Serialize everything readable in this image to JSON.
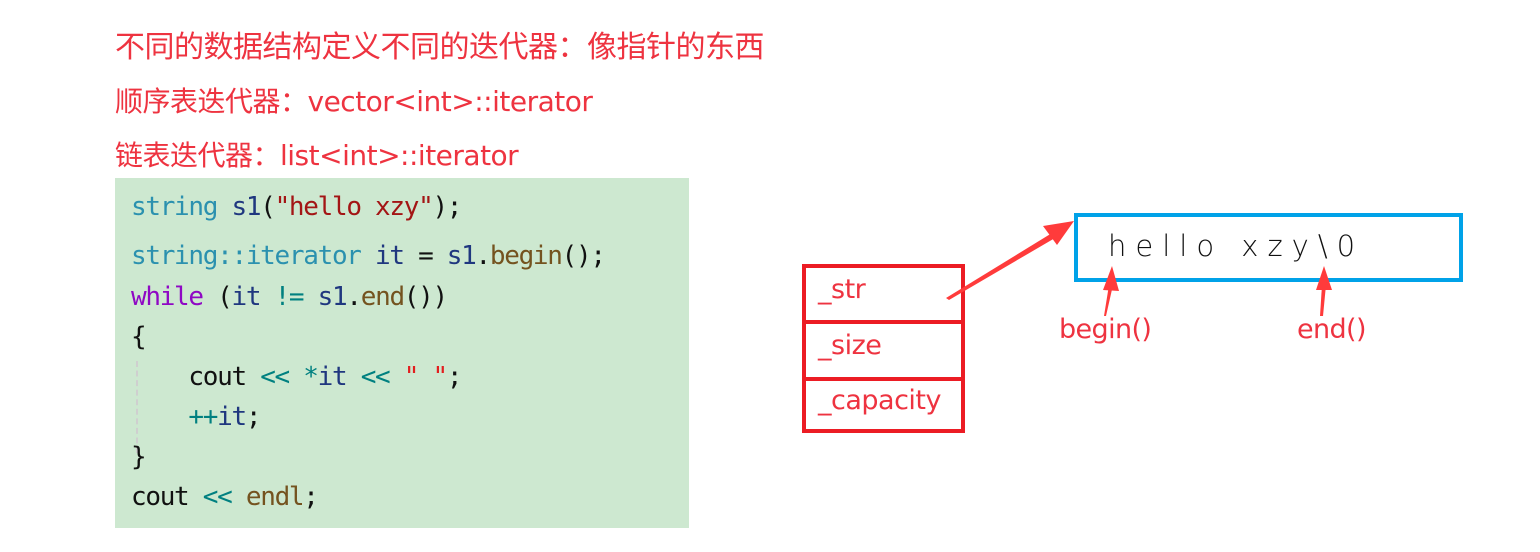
{
  "headings": {
    "line1": "不同的数据结构定义不同的迭代器：像指针的东西",
    "line2": "顺序表迭代器：vector<int>::iterator",
    "line3": "链表迭代器：list<int>::iterator"
  },
  "code": {
    "lines": [
      [
        {
          "t": "string",
          "c": "type"
        },
        {
          "t": " ",
          "c": "plain"
        },
        {
          "t": "s1",
          "c": "var"
        },
        {
          "t": "(",
          "c": "plain"
        },
        {
          "t": "\"hello xzy\"",
          "c": "str"
        },
        {
          "t": ");",
          "c": "plain"
        }
      ],
      [
        {
          "t": "string::iterator",
          "c": "type"
        },
        {
          "t": " ",
          "c": "plain"
        },
        {
          "t": "it",
          "c": "var"
        },
        {
          "t": " = ",
          "c": "plain"
        },
        {
          "t": "s1",
          "c": "var"
        },
        {
          "t": ".",
          "c": "plain"
        },
        {
          "t": "begin",
          "c": "fn"
        },
        {
          "t": "();",
          "c": "plain"
        }
      ],
      [
        {
          "t": "while",
          "c": "kw"
        },
        {
          "t": " (",
          "c": "plain"
        },
        {
          "t": "it",
          "c": "var"
        },
        {
          "t": " ",
          "c": "plain"
        },
        {
          "t": "!=",
          "c": "op"
        },
        {
          "t": " ",
          "c": "plain"
        },
        {
          "t": "s1",
          "c": "var"
        },
        {
          "t": ".",
          "c": "plain"
        },
        {
          "t": "end",
          "c": "fn"
        },
        {
          "t": "())",
          "c": "plain"
        }
      ],
      [
        {
          "t": "{",
          "c": "plain"
        }
      ],
      [
        {
          "t": "    cout ",
          "c": "plain"
        },
        {
          "t": "<<",
          "c": "op"
        },
        {
          "t": " ",
          "c": "plain"
        },
        {
          "t": "*",
          "c": "op"
        },
        {
          "t": "it",
          "c": "var"
        },
        {
          "t": " ",
          "c": "plain"
        },
        {
          "t": "<<",
          "c": "op"
        },
        {
          "t": " ",
          "c": "plain"
        },
        {
          "t": "\" \"",
          "c": "strred"
        },
        {
          "t": ";",
          "c": "plain"
        }
      ],
      [
        {
          "t": "    ",
          "c": "plain"
        },
        {
          "t": "++",
          "c": "op"
        },
        {
          "t": "it",
          "c": "var"
        },
        {
          "t": ";",
          "c": "plain"
        }
      ],
      [
        {
          "t": "}",
          "c": "plain"
        }
      ],
      [
        {
          "t": "cout ",
          "c": "plain"
        },
        {
          "t": "<<",
          "c": "op"
        },
        {
          "t": " ",
          "c": "plain"
        },
        {
          "t": "endl",
          "c": "fn"
        },
        {
          "t": ";",
          "c": "plain"
        }
      ]
    ]
  },
  "diagram": {
    "struct_fields": [
      "_str",
      "_size",
      "_capacity"
    ],
    "buffer_content": "hello xzy\\0",
    "begin_label": "begin()",
    "end_label": "end()",
    "colors": {
      "struct_border": "#ec1c24",
      "buffer_border": "#00a2e8",
      "arrow": "#ff3b3b",
      "text_red": "#ee3340"
    }
  }
}
